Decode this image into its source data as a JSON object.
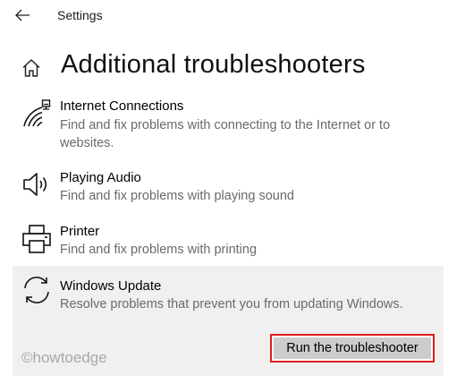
{
  "window": {
    "title": "Settings",
    "back_icon": "back-arrow-icon"
  },
  "page": {
    "home_icon": "home-icon",
    "title": "Additional troubleshooters"
  },
  "troubleshooters": [
    {
      "icon": "network-icon",
      "name": "Internet Connections",
      "description": "Find and fix problems with connecting to the Internet or to websites."
    },
    {
      "icon": "speaker-icon",
      "name": "Playing Audio",
      "description": "Find and fix problems with playing sound"
    },
    {
      "icon": "printer-icon",
      "name": "Printer",
      "description": "Find and fix problems with printing"
    },
    {
      "icon": "sync-icon",
      "name": "Windows Update",
      "description": "Resolve problems that prevent you from updating Windows.",
      "selected": true,
      "action_label": "Run the troubleshooter"
    }
  ],
  "watermark": "©howtoedge",
  "colors": {
    "selected_background": "#f0f0f0",
    "button_background": "#cccccc",
    "highlight_border": "#e01c1c",
    "secondary_text": "#6a6a6a"
  }
}
